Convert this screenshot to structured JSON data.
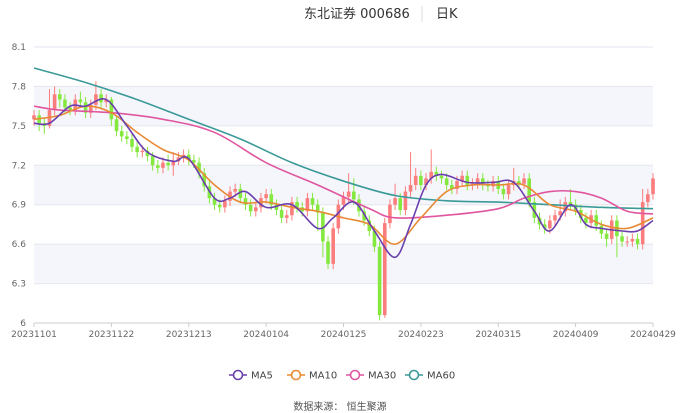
{
  "header": {
    "title": "东北证券 000686",
    "period": "日K"
  },
  "source": "数据来源： 恒生聚源",
  "colors": {
    "up": "#fb7d7d",
    "down": "#84e83f",
    "MA5": "#6a3fad",
    "MA10": "#e88a35",
    "MA30": "#e0559f",
    "MA60": "#3a9a98",
    "band": "#f5f6fb",
    "grid": "#e3e6f0"
  },
  "chart_data": {
    "type": "candlestick",
    "title": "东北证券 000686 日K",
    "ylim": [
      6,
      8.1
    ],
    "yticks": [
      "8.1",
      "7.8",
      "7.5",
      "7.2",
      "6.9",
      "6.6",
      "6.3",
      "6"
    ],
    "ytick_values": [
      8.1,
      7.8,
      7.5,
      7.2,
      6.9,
      6.6,
      6.3,
      6
    ],
    "xticks": [
      "20231101",
      "20231122",
      "20231213",
      "20240104",
      "20240125",
      "20240223",
      "20240315",
      "20240409",
      "20240429"
    ],
    "xtick_index": [
      0,
      15,
      30,
      45,
      60,
      75,
      90,
      105,
      120
    ],
    "legend": [
      "MA5",
      "MA10",
      "MA30",
      "MA60"
    ],
    "legend_placement": "bottom",
    "ohlc_format": "[open, high, low, close]",
    "ohlc": [
      [
        7.55,
        7.62,
        7.5,
        7.58
      ],
      [
        7.58,
        7.62,
        7.46,
        7.52
      ],
      [
        7.52,
        7.56,
        7.44,
        7.5
      ],
      [
        7.5,
        7.78,
        7.48,
        7.62
      ],
      [
        7.62,
        7.8,
        7.58,
        7.74
      ],
      [
        7.74,
        7.78,
        7.64,
        7.7
      ],
      [
        7.7,
        7.74,
        7.6,
        7.64
      ],
      [
        7.64,
        7.68,
        7.58,
        7.62
      ],
      [
        7.62,
        7.74,
        7.58,
        7.7
      ],
      [
        7.7,
        7.76,
        7.64,
        7.68
      ],
      [
        7.68,
        7.72,
        7.56,
        7.6
      ],
      [
        7.6,
        7.7,
        7.56,
        7.66
      ],
      [
        7.66,
        7.84,
        7.62,
        7.74
      ],
      [
        7.74,
        7.78,
        7.64,
        7.68
      ],
      [
        7.68,
        7.74,
        7.64,
        7.7
      ],
      [
        7.7,
        7.72,
        7.5,
        7.55
      ],
      [
        7.55,
        7.58,
        7.42,
        7.46
      ],
      [
        7.46,
        7.5,
        7.38,
        7.42
      ],
      [
        7.42,
        7.46,
        7.36,
        7.4
      ],
      [
        7.4,
        7.44,
        7.3,
        7.34
      ],
      [
        7.34,
        7.38,
        7.26,
        7.3
      ],
      [
        7.3,
        7.35,
        7.26,
        7.31
      ],
      [
        7.31,
        7.34,
        7.23,
        7.27
      ],
      [
        7.27,
        7.3,
        7.16,
        7.2
      ],
      [
        7.2,
        7.24,
        7.14,
        7.18
      ],
      [
        7.18,
        7.26,
        7.14,
        7.22
      ],
      [
        7.22,
        7.28,
        7.16,
        7.2
      ],
      [
        7.2,
        7.3,
        7.12,
        7.23
      ],
      [
        7.23,
        7.3,
        7.2,
        7.26
      ],
      [
        7.26,
        7.32,
        7.22,
        7.28
      ],
      [
        7.28,
        7.32,
        7.2,
        7.24
      ],
      [
        7.24,
        7.28,
        7.18,
        7.22
      ],
      [
        7.22,
        7.26,
        7.1,
        7.14
      ],
      [
        7.14,
        7.18,
        7.0,
        7.04
      ],
      [
        7.04,
        7.08,
        6.91,
        6.95
      ],
      [
        6.95,
        6.99,
        6.86,
        6.9
      ],
      [
        6.9,
        6.94,
        6.84,
        6.88
      ],
      [
        6.88,
        6.97,
        6.84,
        6.93
      ],
      [
        6.93,
        7.04,
        6.89,
        7.0
      ],
      [
        7.0,
        7.06,
        6.96,
        7.02
      ],
      [
        7.02,
        7.06,
        6.91,
        6.95
      ],
      [
        6.95,
        6.99,
        6.86,
        6.9
      ],
      [
        6.9,
        6.94,
        6.81,
        6.85
      ],
      [
        6.85,
        6.92,
        6.81,
        6.88
      ],
      [
        6.88,
        6.99,
        6.84,
        6.95
      ],
      [
        6.95,
        7.02,
        6.91,
        6.98
      ],
      [
        6.98,
        7.02,
        6.86,
        6.9
      ],
      [
        6.9,
        6.94,
        6.82,
        6.86
      ],
      [
        6.86,
        6.9,
        6.76,
        6.8
      ],
      [
        6.8,
        6.86,
        6.76,
        6.82
      ],
      [
        6.82,
        6.96,
        6.78,
        6.92
      ],
      [
        6.92,
        6.96,
        6.84,
        6.88
      ],
      [
        6.88,
        6.92,
        6.81,
        6.85
      ],
      [
        6.85,
        6.99,
        6.81,
        6.95
      ],
      [
        6.95,
        6.99,
        6.86,
        6.9
      ],
      [
        6.9,
        6.94,
        6.7,
        6.84
      ],
      [
        6.84,
        6.88,
        6.5,
        6.62
      ],
      [
        6.62,
        6.66,
        6.41,
        6.45
      ],
      [
        6.45,
        6.76,
        6.41,
        6.72
      ],
      [
        6.72,
        6.94,
        6.68,
        6.9
      ],
      [
        6.9,
        7.0,
        6.86,
        6.96
      ],
      [
        6.96,
        7.14,
        6.92,
        7.0
      ],
      [
        7.0,
        7.1,
        6.9,
        6.94
      ],
      [
        6.94,
        6.98,
        6.81,
        6.85
      ],
      [
        6.85,
        6.89,
        6.74,
        6.78
      ],
      [
        6.78,
        6.82,
        6.66,
        6.7
      ],
      [
        6.7,
        6.74,
        6.54,
        6.58
      ],
      [
        6.58,
        6.62,
        6.02,
        6.06
      ],
      [
        6.06,
        6.8,
        6.04,
        6.76
      ],
      [
        6.76,
        6.94,
        6.72,
        6.9
      ],
      [
        6.9,
        7.06,
        6.86,
        6.95
      ],
      [
        6.95,
        6.99,
        6.82,
        6.86
      ],
      [
        6.86,
        7.04,
        6.82,
        7.0
      ],
      [
        7.0,
        7.3,
        6.96,
        7.05
      ],
      [
        7.05,
        7.18,
        7.01,
        7.12
      ],
      [
        7.12,
        7.16,
        7.01,
        7.05
      ],
      [
        7.05,
        7.14,
        7.01,
        7.1
      ],
      [
        7.1,
        7.32,
        7.06,
        7.15
      ],
      [
        7.15,
        7.19,
        7.08,
        7.12
      ],
      [
        7.12,
        7.16,
        7.06,
        7.1
      ],
      [
        7.1,
        7.14,
        7.01,
        7.05
      ],
      [
        7.05,
        7.09,
        6.98,
        7.02
      ],
      [
        7.02,
        7.12,
        6.98,
        7.08
      ],
      [
        7.08,
        7.16,
        7.04,
        7.12
      ],
      [
        7.12,
        7.16,
        7.01,
        7.05
      ],
      [
        7.05,
        7.1,
        7.01,
        7.06
      ],
      [
        7.06,
        7.14,
        7.02,
        7.1
      ],
      [
        7.1,
        7.14,
        7.01,
        7.05
      ],
      [
        7.05,
        7.09,
        7.0,
        7.04
      ],
      [
        7.04,
        7.12,
        7.0,
        7.08
      ],
      [
        7.08,
        7.12,
        6.98,
        7.02
      ],
      [
        7.02,
        7.06,
        6.94,
        6.98
      ],
      [
        6.98,
        7.09,
        6.94,
        7.05
      ],
      [
        7.05,
        7.18,
        7.01,
        7.08
      ],
      [
        7.08,
        7.12,
        7.02,
        7.06
      ],
      [
        7.06,
        7.14,
        7.02,
        7.1
      ],
      [
        7.1,
        7.14,
        6.88,
        6.92
      ],
      [
        6.92,
        6.96,
        6.76,
        6.8
      ],
      [
        6.8,
        6.84,
        6.71,
        6.75
      ],
      [
        6.75,
        6.79,
        6.68,
        6.72
      ],
      [
        6.72,
        6.82,
        6.68,
        6.78
      ],
      [
        6.78,
        6.86,
        6.74,
        6.82
      ],
      [
        6.82,
        6.94,
        6.78,
        6.85
      ],
      [
        6.85,
        6.96,
        6.81,
        6.92
      ],
      [
        6.92,
        7.02,
        6.86,
        6.9
      ],
      [
        6.9,
        6.94,
        6.82,
        6.86
      ],
      [
        6.86,
        6.9,
        6.76,
        6.8
      ],
      [
        6.8,
        6.84,
        6.72,
        6.76
      ],
      [
        6.76,
        6.86,
        6.72,
        6.82
      ],
      [
        6.82,
        6.86,
        6.7,
        6.74
      ],
      [
        6.74,
        6.78,
        6.64,
        6.68
      ],
      [
        6.68,
        6.72,
        6.58,
        6.64
      ],
      [
        6.64,
        6.82,
        6.6,
        6.78
      ],
      [
        6.78,
        6.82,
        6.5,
        6.66
      ],
      [
        6.66,
        6.7,
        6.58,
        6.62
      ],
      [
        6.62,
        6.66,
        6.58,
        6.62
      ],
      [
        6.62,
        6.68,
        6.58,
        6.64
      ],
      [
        6.64,
        6.68,
        6.56,
        6.6
      ],
      [
        6.6,
        7.02,
        6.56,
        6.92
      ],
      [
        6.92,
        7.02,
        6.88,
        6.98
      ],
      [
        6.98,
        7.14,
        6.94,
        7.1
      ]
    ],
    "ma_series": [
      {
        "name": "MA5",
        "points": [
          [
            0,
            7.52
          ],
          [
            3,
            7.52
          ],
          [
            7,
            7.65
          ],
          [
            10,
            7.65
          ],
          [
            14,
            7.7
          ],
          [
            18,
            7.5
          ],
          [
            22,
            7.3
          ],
          [
            27,
            7.23
          ],
          [
            30,
            7.25
          ],
          [
            35,
            6.95
          ],
          [
            38,
            6.95
          ],
          [
            41,
            7.0
          ],
          [
            45,
            6.88
          ],
          [
            50,
            6.9
          ],
          [
            55,
            6.72
          ],
          [
            58,
            6.8
          ],
          [
            62,
            6.92
          ],
          [
            66,
            6.7
          ],
          [
            70,
            6.5
          ],
          [
            73,
            6.75
          ],
          [
            76,
            7.05
          ],
          [
            79,
            7.13
          ],
          [
            84,
            7.07
          ],
          [
            89,
            7.07
          ],
          [
            93,
            7.07
          ],
          [
            97,
            6.85
          ],
          [
            100,
            6.7
          ],
          [
            104,
            6.9
          ],
          [
            107,
            6.75
          ],
          [
            110,
            6.72
          ],
          [
            114,
            6.7
          ],
          [
            117,
            6.7
          ],
          [
            120,
            6.78
          ]
        ]
      },
      {
        "name": "MA10",
        "points": [
          [
            0,
            7.55
          ],
          [
            5,
            7.58
          ],
          [
            10,
            7.65
          ],
          [
            15,
            7.6
          ],
          [
            20,
            7.45
          ],
          [
            25,
            7.32
          ],
          [
            30,
            7.24
          ],
          [
            35,
            7.05
          ],
          [
            40,
            6.92
          ],
          [
            45,
            6.92
          ],
          [
            50,
            6.88
          ],
          [
            55,
            6.85
          ],
          [
            60,
            6.8
          ],
          [
            65,
            6.75
          ],
          [
            70,
            6.6
          ],
          [
            75,
            6.8
          ],
          [
            80,
            7.0
          ],
          [
            85,
            7.05
          ],
          [
            90,
            7.05
          ],
          [
            95,
            7.05
          ],
          [
            100,
            6.9
          ],
          [
            105,
            6.85
          ],
          [
            110,
            6.75
          ],
          [
            115,
            6.72
          ],
          [
            120,
            6.8
          ]
        ]
      },
      {
        "name": "MA30",
        "points": [
          [
            0,
            7.65
          ],
          [
            5,
            7.62
          ],
          [
            15,
            7.6
          ],
          [
            25,
            7.55
          ],
          [
            35,
            7.45
          ],
          [
            45,
            7.22
          ],
          [
            55,
            7.05
          ],
          [
            65,
            6.87
          ],
          [
            70,
            6.8
          ],
          [
            80,
            6.82
          ],
          [
            90,
            6.87
          ],
          [
            95,
            6.95
          ],
          [
            100,
            7.0
          ],
          [
            105,
            7.0
          ],
          [
            110,
            6.95
          ],
          [
            115,
            6.85
          ],
          [
            120,
            6.83
          ]
        ]
      },
      {
        "name": "MA60",
        "points": [
          [
            0,
            7.94
          ],
          [
            10,
            7.83
          ],
          [
            20,
            7.7
          ],
          [
            30,
            7.55
          ],
          [
            40,
            7.4
          ],
          [
            50,
            7.22
          ],
          [
            60,
            7.08
          ],
          [
            70,
            6.97
          ],
          [
            80,
            6.93
          ],
          [
            90,
            6.92
          ],
          [
            100,
            6.9
          ],
          [
            110,
            6.88
          ],
          [
            120,
            6.87
          ]
        ]
      }
    ]
  }
}
